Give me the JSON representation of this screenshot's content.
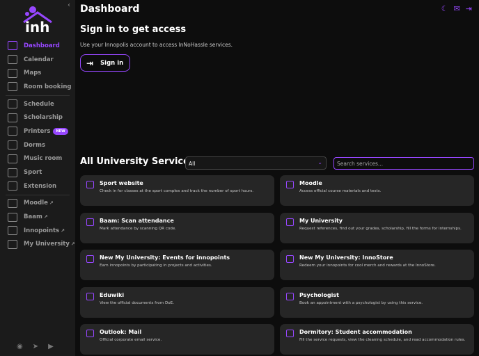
{
  "sidebar": {
    "items": [
      {
        "label": "Dashboard",
        "icon": "dashboard-icon",
        "active": true
      },
      {
        "label": "Calendar",
        "icon": "calendar-icon"
      },
      {
        "label": "Maps",
        "icon": "map-icon"
      },
      {
        "label": "Room booking",
        "icon": "door-icon"
      },
      {
        "label": "Schedule",
        "icon": "schedule-icon"
      },
      {
        "label": "Scholarship",
        "icon": "card-icon"
      },
      {
        "label": "Printers",
        "icon": "printer-icon",
        "badge": "NEW"
      },
      {
        "label": "Dorms",
        "icon": "dorm-icon"
      },
      {
        "label": "Music room",
        "icon": "piano-icon"
      },
      {
        "label": "Sport",
        "icon": "dumbbell-icon"
      },
      {
        "label": "Extension",
        "icon": "puzzle-icon"
      },
      {
        "label": "Moodle",
        "icon": "graduation-cap-icon",
        "external": true
      },
      {
        "label": "Baam",
        "icon": "qr-icon",
        "external": true
      },
      {
        "label": "Innopoints",
        "icon": "tag-icon",
        "external": true
      },
      {
        "label": "My University",
        "icon": "user-circle-icon",
        "external": true
      }
    ],
    "badge_new": "NEW"
  },
  "header": {
    "title": "Dashboard"
  },
  "signin": {
    "heading": "Sign in to get access",
    "subtitle": "Use your Innopolis account to access InNoHassle services.",
    "button": "Sign in"
  },
  "services": {
    "heading": "All University Services",
    "filter": "All",
    "search_placeholder": "Search services...",
    "cards": [
      {
        "title": "Sport website",
        "desc": "Check in for classes at the sport complex and track the number of sport hours."
      },
      {
        "title": "Moodle",
        "desc": "Access official course materials and tests."
      },
      {
        "title": "Baam: Scan attendance",
        "desc": "Mark attendance by scanning QR code."
      },
      {
        "title": "My University",
        "desc": "Request references, find out your grades, scholarship, fill the forms for internships."
      },
      {
        "title": "New My University: Events for innopoints",
        "desc": "Earn innopoints by participating in projects and activities."
      },
      {
        "title": "New My University: InnoStore",
        "desc": "Redeem your innopoints for cool merch and rewards at the InnoStore."
      },
      {
        "title": "Eduwiki",
        "desc": "View the official documents from DoE."
      },
      {
        "title": "Psychologist",
        "desc": "Book an appointment with a psychologist by using this service."
      },
      {
        "title": "Outlook: Mail",
        "desc": "Official corporate email service."
      },
      {
        "title": "Dormitory: Student accommodation",
        "desc": "Fill the service requests, view the cleaning schedule, and read accommodation rules."
      }
    ]
  },
  "colors": {
    "accent": "#9747ff",
    "card": "#262626",
    "sidebar": "#1b1b1b"
  }
}
